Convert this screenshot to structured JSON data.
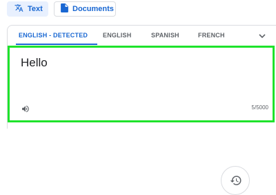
{
  "mode_buttons": {
    "text_label": "Text",
    "documents_label": "Documents"
  },
  "language_tabs": [
    {
      "label": "ENGLISH - DETECTED",
      "active": true
    },
    {
      "label": "ENGLISH",
      "active": false
    },
    {
      "label": "SPANISH",
      "active": false
    },
    {
      "label": "FRENCH",
      "active": false
    }
  ],
  "source": {
    "text": "Hello",
    "char_count": "5/5000"
  },
  "icons": {
    "text_mode": "translate-icon",
    "documents_mode": "document-icon",
    "more_languages": "chevron-down-icon",
    "listen": "speaker-icon",
    "history": "history-icon"
  },
  "colors": {
    "accent": "#1967d2",
    "highlight_border": "#1ee32b"
  }
}
